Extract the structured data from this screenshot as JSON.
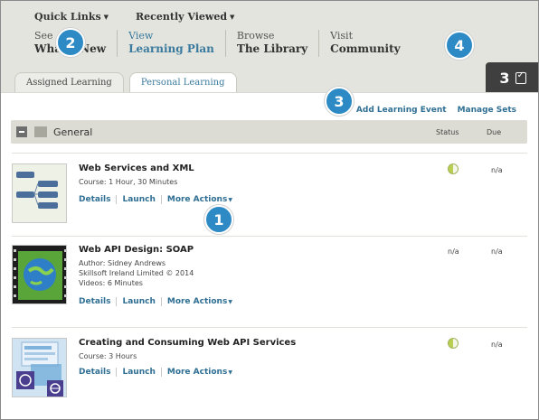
{
  "top_links": {
    "quick_links": "Quick Links",
    "recently_viewed": "Recently Viewed"
  },
  "nav": [
    {
      "line1": "See",
      "line2": "What's New"
    },
    {
      "line1": "View",
      "line2": "Learning Plan"
    },
    {
      "line1": "Browse",
      "line2": "The Library"
    },
    {
      "line1": "Visit",
      "line2": "Community"
    }
  ],
  "tabs": [
    "Assigned Learning",
    "Personal Learning"
  ],
  "side_panel": {
    "number": "3",
    "icon": "checklist-icon"
  },
  "callouts": [
    "1",
    "2",
    "3",
    "4"
  ],
  "actions": {
    "add": "Add Learning Event",
    "manage": "Manage Sets"
  },
  "group": {
    "label": "General",
    "status_header": "Status",
    "due_header": "Due"
  },
  "items": [
    {
      "title": "Web Services and XML",
      "meta": [
        "Course: 1 Hour, 30 Minutes"
      ],
      "links": [
        "Details",
        "Launch",
        "More Actions"
      ],
      "status": "half-complete",
      "due": "n/a"
    },
    {
      "title": "Web API Design: SOAP",
      "meta": [
        "Author: Sidney Andrews",
        "Skillsoft Ireland Limited © 2014",
        "Videos: 6 Minutes"
      ],
      "links": [
        "Details",
        "Launch",
        "More Actions"
      ],
      "status": "n/a",
      "due": "n/a"
    },
    {
      "title": "Creating and Consuming Web API Services",
      "meta": [
        "Course: 3 Hours"
      ],
      "links": [
        "Details",
        "Launch",
        "More Actions"
      ],
      "status": "half-complete",
      "due": "n/a"
    }
  ],
  "colors": {
    "accent_link": "#2f6f93",
    "callout": "#2e8ac4",
    "status_green": "#b9cf52",
    "header_bg": "#e3e4dd"
  }
}
